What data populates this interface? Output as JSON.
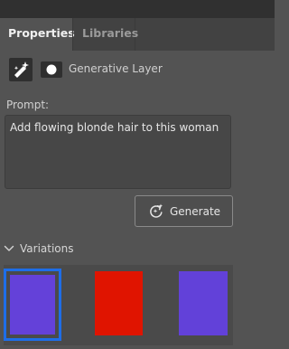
{
  "tabs": {
    "properties": "Properties",
    "libraries": "Libraries"
  },
  "layer": {
    "label": "Generative Layer",
    "icon": "generative-layer-icon",
    "mask_icon": "layer-mask-icon"
  },
  "prompt": {
    "label": "Prompt:",
    "value": "Add flowing blonde hair to this woman"
  },
  "generate": {
    "label": "Generate",
    "icon": "sparkle-refresh-icon"
  },
  "variations": {
    "label": "Variations",
    "expanded": true,
    "items": [
      {
        "color": "#6441d9",
        "selected": true
      },
      {
        "color": "#e01400",
        "selected": false
      },
      {
        "color": "#6241d9",
        "selected": false
      }
    ]
  },
  "colors": {
    "panel_bg": "#535353",
    "selection_border": "#1e6ee8"
  }
}
